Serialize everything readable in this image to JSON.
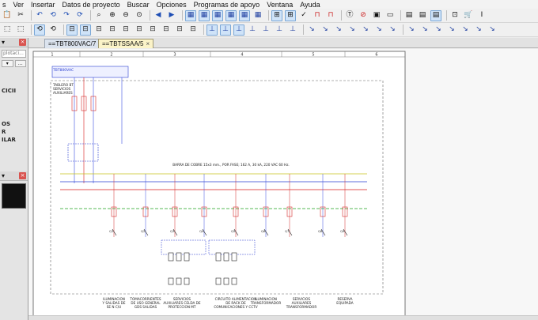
{
  "menubar": {
    "items": [
      "s",
      "Ver",
      "Insertar",
      "Datos de proyecto",
      "Buscar",
      "Opciones",
      "Programas de apoyo",
      "Ventana",
      "Ayuda"
    ]
  },
  "toolbar1": {
    "icons": [
      "paste-icon",
      "cut-icon",
      "undo-icon",
      "undo-all-icon",
      "redo-icon",
      "redo-all-icon",
      "zoom-window-icon",
      "zoom-in-icon",
      "zoom-out-icon",
      "zoom-all-icon",
      "back-icon",
      "forward-icon",
      "grid-icon",
      "grid-icon",
      "grid-icon",
      "grid-icon",
      "grid-icon",
      "grid-icon",
      "snap-icon",
      "snap-icon",
      "check-icon",
      "route-icon",
      "route-icon",
      "text-icon",
      "hide-icon",
      "image-icon",
      "box-icon",
      "page-icon",
      "page-icon",
      "page-icon",
      "zoom-sheet-icon",
      "cart-icon",
      "text-cursor-icon"
    ]
  },
  "toolbar2": {
    "icons": [
      "select-icon",
      "select-icon",
      "rotate-icon",
      "rotate-icon",
      "device-icon",
      "device-icon",
      "device-icon",
      "device-icon",
      "device-icon",
      "device-icon",
      "device-icon",
      "device-icon",
      "device-icon",
      "device-icon",
      "connect-icon",
      "connect-icon",
      "connect-icon",
      "connect-icon",
      "connect-icon",
      "connect-icon",
      "connect-icon",
      "wire-icon",
      "wire-icon",
      "wire-icon",
      "wire-icon",
      "wire-icon",
      "wire-icon",
      "wire-icon",
      "wire-icon",
      "wire-icon",
      "wire-icon",
      "wire-icon",
      "wire-icon",
      "wire-icon",
      "wire-icon"
    ]
  },
  "left_panel": {
    "field_text": "plotaci...",
    "label_1": "CICII",
    "label_2": "OS",
    "label_3": "R",
    "label_4": "ILAR"
  },
  "tabs": [
    {
      "label": "==TBT800VAC/7"
    },
    {
      "label": "==TBTSSAA/5"
    }
  ],
  "schematic": {
    "column_numbers": [
      "1",
      "2",
      "3",
      "4",
      "5",
      "6"
    ],
    "header_board": "TBT800VAC",
    "board_description": [
      "TABLERO BT",
      "SERVICIOS",
      "AUXILIARES"
    ],
    "busbar_note": "BARRA DE COBRE 15x3 mm., POR FASE; 162 A, 30 kA, 220 VAC 60 Hz.",
    "circuit_labels": [
      {
        "lines": [
          "ILUMINACION",
          "Y SALIDAS DE",
          "SE N C/U"
        ]
      },
      {
        "lines": [
          "TOMACORRIENTES",
          "DE USO GENERAL",
          "GDS SALIDAS"
        ]
      },
      {
        "lines": [
          "SERVICIOS",
          "AUXILIARES CELDA DE",
          "PROTECCION MT"
        ]
      },
      {
        "lines": [
          "CIRCUITO ALIMENTACION",
          "DE RACK DE",
          "COMUNICACIONES Y CCTV"
        ]
      },
      {
        "lines": [
          "ILUMINACION",
          "TRANSFORMADOR"
        ]
      },
      {
        "lines": [
          "SERVICIOS",
          "AUXILIARES",
          "TRANSFORMADOR"
        ]
      },
      {
        "lines": [
          "RESERVA",
          "EQUIPADA"
        ]
      }
    ]
  },
  "colors": {
    "busbar_red": "#d81b1b",
    "busbar_blue": "#2a3fd0",
    "busbar_yellow": "#c7c21a",
    "neutral_green": "#1da31d",
    "conductor_blue": "#3b4fe0",
    "breaker_red": "#d42a2a"
  }
}
